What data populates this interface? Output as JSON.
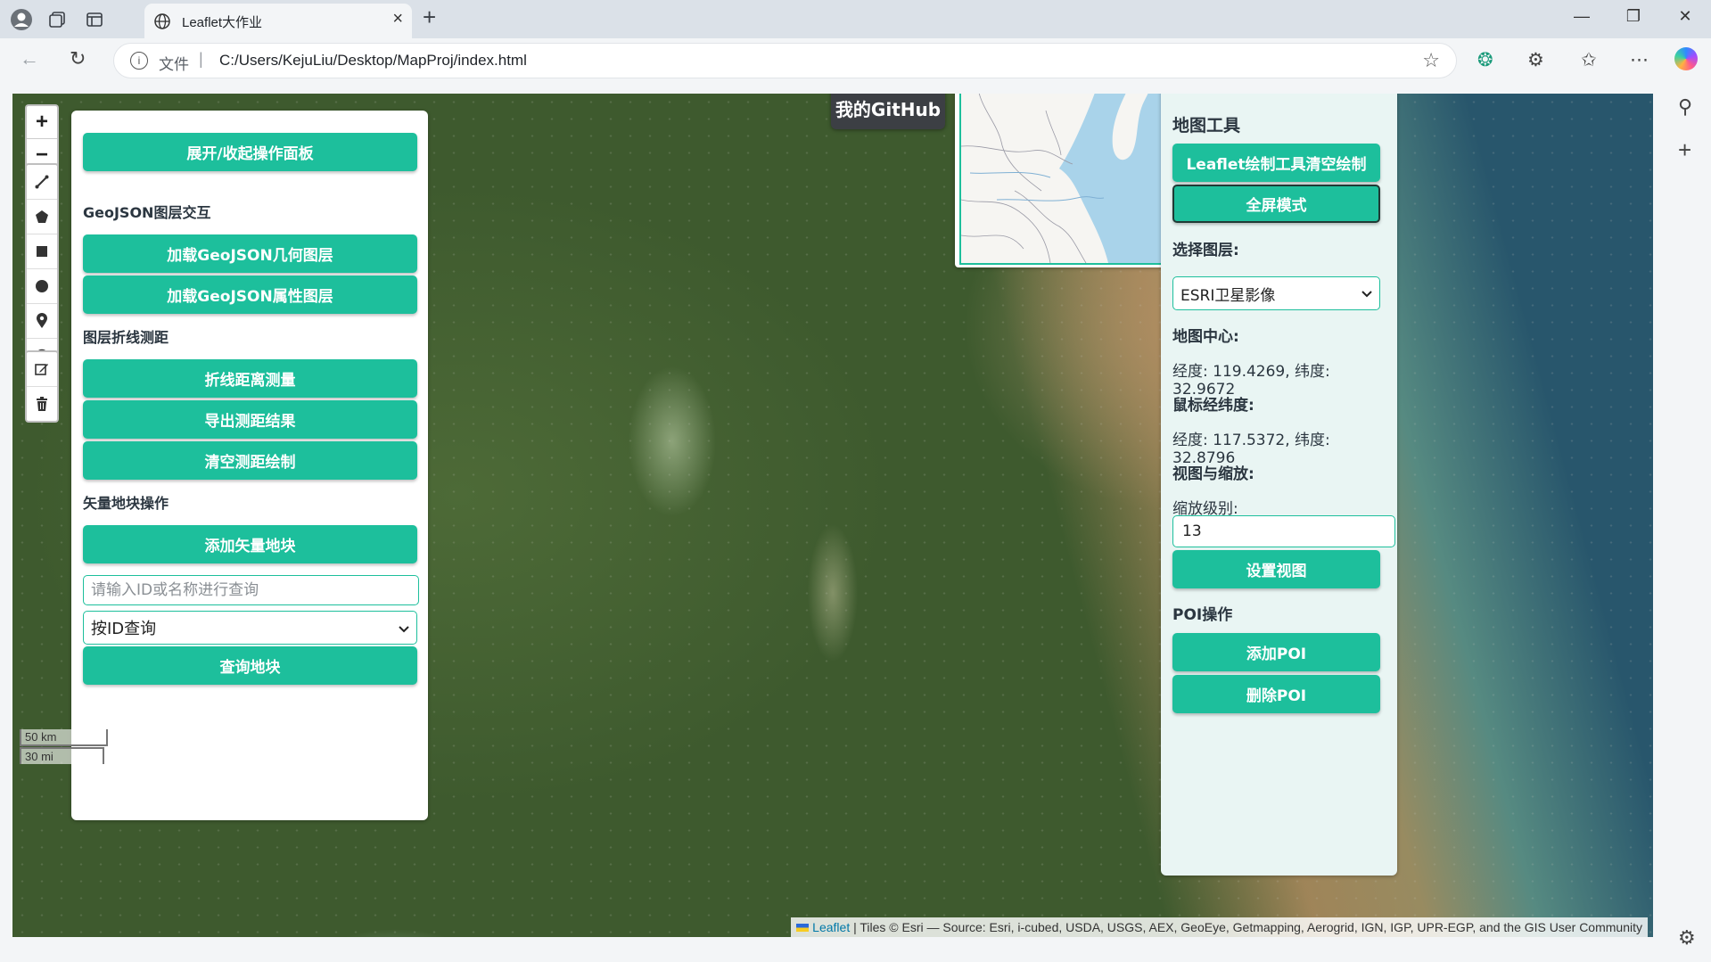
{
  "browser": {
    "tab_title": "Leaflet大作业",
    "url_protocol_label": "文件",
    "url": "C:/Users/KejuLiu/Desktop/MapProj/index.html"
  },
  "map": {
    "zoom_in": "+",
    "zoom_out": "−",
    "draw_tools": [
      "polyline-icon",
      "polygon-icon",
      "rectangle-icon",
      "circle-marker-icon",
      "marker-icon",
      "circle-icon"
    ],
    "edit_tools": [
      "edit-icon",
      "delete-icon"
    ],
    "github_label": "我的GitHub",
    "scale_metric": "50 km",
    "scale_imperial": "30 mi",
    "attribution_link": "Leaflet",
    "attribution_text": " | Tiles © Esri — Source: Esri, i-cubed, USDA, USGS, AEX, GeoEye, Getmapping, Aerogrid, IGN, IGP, UPR-EGP, and the GIS User Community"
  },
  "left_panel": {
    "toggle_button": "展开/收起操作面板",
    "geojson_heading": "GeoJSON图层交互",
    "load_geometry_button": "加载GeoJSON几何图层",
    "load_attribute_button": "加载GeoJSON属性图层",
    "measure_heading": "图层折线测距",
    "measure_button": "折线距离测量",
    "export_button": "导出测距结果",
    "clear_measure_button": "清空测距绘制",
    "vector_heading": "矢量地块操作",
    "add_vector_button": "添加矢量地块",
    "query_placeholder": "请输入ID或名称进行查询",
    "query_mode": "按ID查询",
    "query_button": "查询地块"
  },
  "right_panel": {
    "title": "地图工具",
    "clear_draw_button": "Leaflet绘制工具清空绘制",
    "fullscreen_button": "全屏模式",
    "layer_heading": "选择图层:",
    "layer_selected": "ESRI卫星影像",
    "center_heading": "地图中心:",
    "center_value": "经度: 119.4269, 纬度: 32.9672",
    "mouse_heading": "鼠标经纬度:",
    "mouse_value": "经度: 117.5372, 纬度: 32.8796",
    "view_heading": "视图与缩放:",
    "zoom_label": "缩放级别:",
    "zoom_value": "13",
    "set_view_button": "设置视图",
    "poi_heading": "POI操作",
    "add_poi_button": "添加POI",
    "delete_poi_button": "删除POI"
  },
  "colors": {
    "accent": "#1dbf9c",
    "panel_bg": "#ffffff",
    "right_panel_bg": "#e9f5f3",
    "github_bg": "#3c3f44"
  }
}
